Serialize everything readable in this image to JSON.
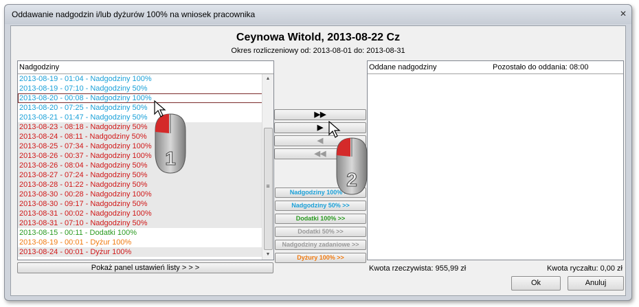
{
  "window": {
    "title": "Oddawanie nadgodzin i/lub dyżurów 100% na wniosek pracownika",
    "close_glyph": "✕"
  },
  "header": {
    "name": "Ceynowa Witold, 2013-08-22 Cz",
    "period": "Okres rozliczeniowy od: 2013-08-01 do: 2013-08-31"
  },
  "left_panel": {
    "title": "Nadgodziny",
    "items": [
      {
        "text": "2013-08-19 - 01:04 - Nadgodziny 100%",
        "color": "#1aa0d8",
        "shaded": false,
        "selected": false
      },
      {
        "text": "2013-08-19 - 07:10 - Nadgodziny 50%",
        "color": "#1aa0d8",
        "shaded": false,
        "selected": false
      },
      {
        "text": "2013-08-20 - 00:08 - Nadgodziny 100%",
        "color": "#1aa0d8",
        "shaded": false,
        "selected": true
      },
      {
        "text": "2013-08-20 - 07:25 - Nadgodziny 50%",
        "color": "#1aa0d8",
        "shaded": false,
        "selected": false
      },
      {
        "text": "2013-08-21 - 01:47 - Nadgodziny 50%",
        "color": "#1aa0d8",
        "shaded": false,
        "selected": false
      },
      {
        "text": "2013-08-23 - 08:18 - Nadgodziny 50%",
        "color": "#d01818",
        "shaded": true,
        "selected": false
      },
      {
        "text": "2013-08-24 - 08:11 - Nadgodziny 50%",
        "color": "#d01818",
        "shaded": true,
        "selected": false
      },
      {
        "text": "2013-08-25 - 07:34 - Nadgodziny 100%",
        "color": "#d01818",
        "shaded": true,
        "selected": false
      },
      {
        "text": "2013-08-26 - 00:37 - Nadgodziny 100%",
        "color": "#d01818",
        "shaded": true,
        "selected": false
      },
      {
        "text": "2013-08-26 - 08:04 - Nadgodziny 50%",
        "color": "#d01818",
        "shaded": true,
        "selected": false
      },
      {
        "text": "2013-08-27 - 07:24 - Nadgodziny 50%",
        "color": "#d01818",
        "shaded": true,
        "selected": false
      },
      {
        "text": "2013-08-28 - 01:22 - Nadgodziny 50%",
        "color": "#d01818",
        "shaded": true,
        "selected": false
      },
      {
        "text": "2013-08-30 - 00:28 - Nadgodziny 100%",
        "color": "#d01818",
        "shaded": true,
        "selected": false
      },
      {
        "text": "2013-08-30 - 09:17 - Nadgodziny 50%",
        "color": "#d01818",
        "shaded": true,
        "selected": false
      },
      {
        "text": "2013-08-31 - 00:02 - Nadgodziny 100%",
        "color": "#d01818",
        "shaded": true,
        "selected": false
      },
      {
        "text": "2013-08-31 - 07:10 - Nadgodziny 50%",
        "color": "#d01818",
        "shaded": true,
        "selected": false
      },
      {
        "text": "2013-08-15 - 00:11 - Dodatki 100%",
        "color": "#2a9a20",
        "shaded": false,
        "selected": false
      },
      {
        "text": "2013-08-19 - 00:01 - Dyżur 100%",
        "color": "#f07a10",
        "shaded": false,
        "selected": false
      },
      {
        "text": "2013-08-24 - 00:01 - Dyżur 100%",
        "color": "#d01818",
        "shaded": true,
        "selected": false
      }
    ],
    "settings_button": "Pokaż panel ustawień listy > > >"
  },
  "transfer_buttons": {
    "move_all": "▶▶",
    "move_one": "▶",
    "back_one": "◀",
    "back_all": "◀◀"
  },
  "filter_buttons": [
    {
      "label": "Nadgodziny 100% >>",
      "color": "#1aa0d8",
      "enabled": true
    },
    {
      "label": "Nadgodziny 50% >>",
      "color": "#1aa0d8",
      "enabled": true
    },
    {
      "label": "Dodatki 100% >>",
      "color": "#2a9a20",
      "enabled": true
    },
    {
      "label": "Dodatki 50% >>",
      "color": "#9a9a9a",
      "enabled": false
    },
    {
      "label": "Nadgodziny zadaniowe >>",
      "color": "#9a9a9a",
      "enabled": false
    },
    {
      "label": "Dyżury 100% >>",
      "color": "#f07a10",
      "enabled": true
    }
  ],
  "right_panel": {
    "title": "Oddane nadgodziny",
    "remaining": "Pozostało do oddania: 08:00"
  },
  "footer": {
    "amount_actual": "Kwota rzeczywista: 955,99 zł",
    "amount_lump": "Kwota ryczałtu: 0,00 zł",
    "ok": "Ok",
    "cancel": "Anuluj"
  },
  "annotations": {
    "mouse1_label": "1",
    "mouse2_label": "2"
  }
}
